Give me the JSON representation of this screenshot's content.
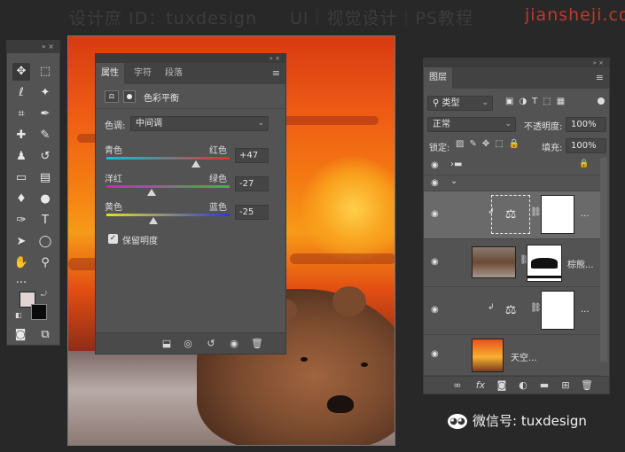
{
  "watermark": {
    "left": "设计庶 ID：tuxdesign",
    "middle": "UI｜视觉设计｜PS教程",
    "right": "jiansheji.com"
  },
  "toolbox": {
    "header_icons": "» ×"
  },
  "properties": {
    "tabs": [
      "属性",
      "字符",
      "段落"
    ],
    "active_tab": "属性",
    "adjustment_name": "色彩平衡",
    "tone_label": "色调:",
    "tone_value": "中间调",
    "sliders": [
      {
        "left": "青色",
        "right": "红色",
        "value": "+47",
        "pos": 0.73
      },
      {
        "left": "洋红",
        "right": "绿色",
        "value": "-27",
        "pos": 0.37
      },
      {
        "left": "黄色",
        "right": "蓝色",
        "value": "-25",
        "pos": 0.38
      }
    ],
    "preserve_luminosity": "保留明度"
  },
  "layers": {
    "tab": "图层",
    "filter_kind": "类型",
    "blend_mode": "正常",
    "opacity_label": "不透明度:",
    "opacity_value": "100%",
    "lock_label": "锁定:",
    "fill_label": "填充:",
    "fill_value": "100%",
    "rows": [
      {
        "name": "..."
      },
      {
        "name": "棕熊..."
      },
      {
        "name": "..."
      },
      {
        "name": "天空..."
      }
    ]
  },
  "wechat": {
    "label": "微信号: tuxdesign"
  },
  "colors": {
    "panel_bg": "#535353",
    "app_bg": "#282828",
    "accent_red": "#c0392b"
  }
}
